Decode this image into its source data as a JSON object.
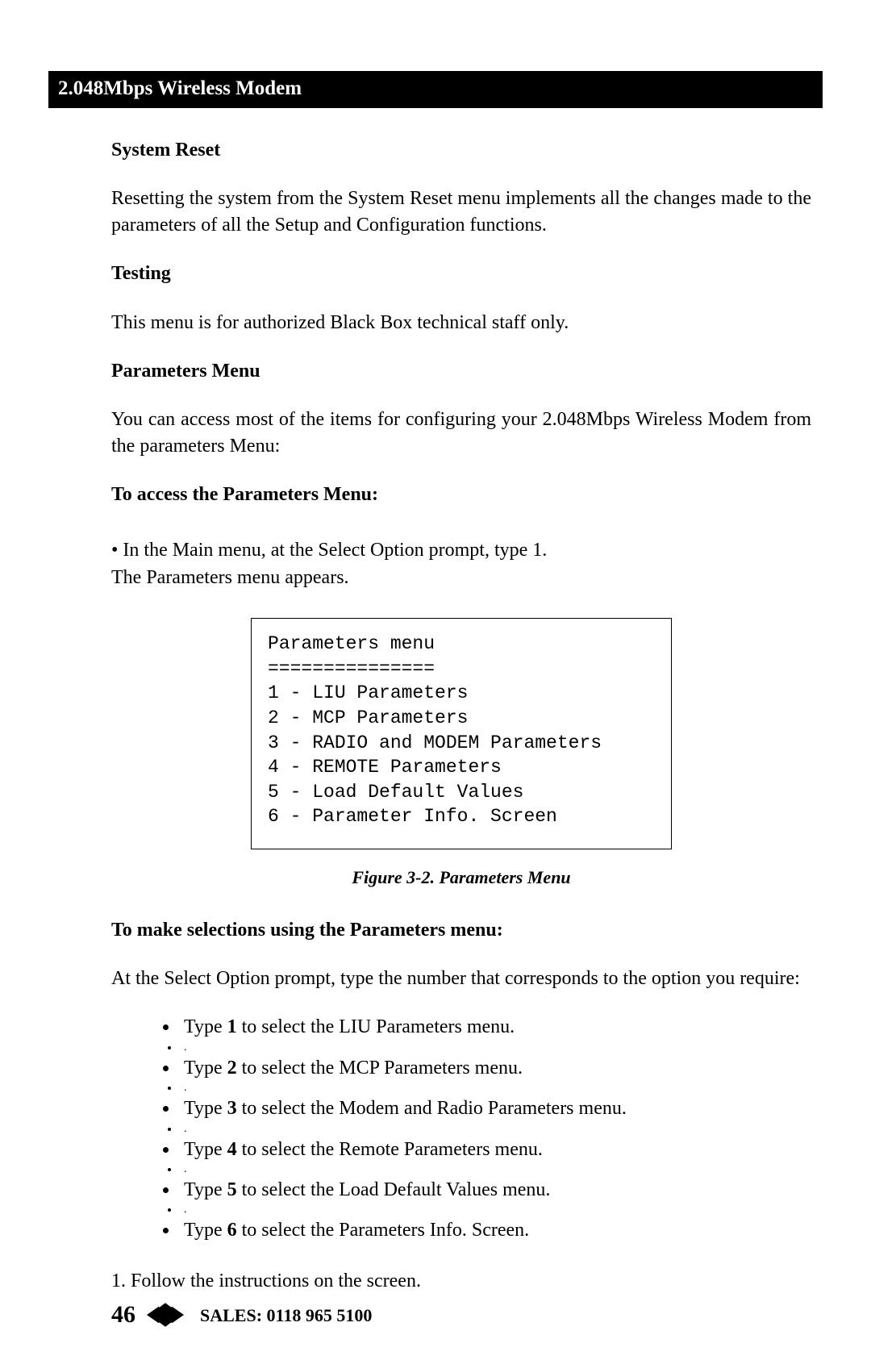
{
  "header": {
    "title": "2.048Mbps Wireless Modem"
  },
  "sections": {
    "system_reset": {
      "heading": "System Reset",
      "body": "Resetting the system from the System Reset menu implements all the changes made to the parameters of all the Setup and Configuration functions."
    },
    "testing": {
      "heading": "Testing",
      "body": "This menu is for authorized Black Box technical staff only."
    },
    "parameters_menu": {
      "heading": "Parameters Menu",
      "body": "You can access most of the items for configuring your 2.048Mbps Wireless Modem from the parameters Menu:"
    },
    "access": {
      "heading": "To access the Parameters Menu:",
      "bullet_prefix": "• ",
      "bullet_text": "In the Main menu, at the Select Option prompt, type 1.",
      "follow": "The Parameters menu appears."
    },
    "menu_box": "Parameters menu\n===============\n1 - LIU Parameters\n2 - MCP Parameters\n3 - RADIO and MODEM Parameters\n4 - REMOTE Parameters\n5 - Load Default Values\n6 - Parameter Info. Screen",
    "figure_caption": "Figure 3-2. Parameters Menu",
    "selections": {
      "heading": "To make selections using the Parameters menu:",
      "intro": "At the Select Option prompt, type the number that corresponds to the option you require:",
      "items": [
        {
          "pre": "Type ",
          "bold": "1",
          "post": " to select the LIU Parameters menu."
        },
        {
          "pre": "Type ",
          "bold": "2",
          "post": " to select the MCP Parameters menu."
        },
        {
          "pre": "Type ",
          "bold": "3",
          "post": " to select the Modem and Radio Parameters menu."
        },
        {
          "pre": "Type ",
          "bold": "4",
          "post": " to select the Remote Parameters menu."
        },
        {
          "pre": "Type ",
          "bold": "5",
          "post": " to select the Load Default Values menu."
        },
        {
          "pre": "Type ",
          "bold": "6",
          "post": " to select the Parameters Info. Screen."
        }
      ],
      "follow": "1. Follow the instructions on the screen."
    }
  },
  "footer": {
    "page_number": "46",
    "sales": "SALES: 0118 965 5100"
  }
}
